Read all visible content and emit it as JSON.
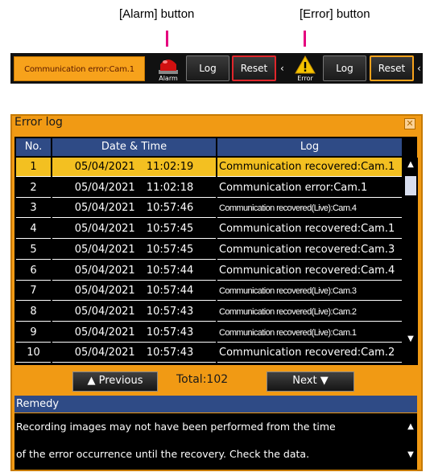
{
  "callouts": {
    "alarm": "[Alarm] button",
    "error": "[Error] button"
  },
  "topbar": {
    "status_text": "Communication error:Cam.1",
    "alarm_label": "Alarm",
    "error_label": "Error",
    "log_label": "Log",
    "reset_label": "Reset",
    "colors": {
      "status": "#f7a21b",
      "alarm_reset_border": "#e0262b",
      "error_reset_border": "#f7a21b"
    }
  },
  "window": {
    "title": "Error log",
    "close_icon": "close-icon",
    "columns": [
      "No.",
      "Date & Time",
      "Log"
    ],
    "rows": [
      {
        "no": "1",
        "date": "05/04/2021",
        "time": "11:02:19",
        "log": "Communication recovered:Cam.1",
        "selected": true,
        "cond": false
      },
      {
        "no": "2",
        "date": "05/04/2021",
        "time": "11:02:18",
        "log": "Communication error:Cam.1",
        "cond": false
      },
      {
        "no": "3",
        "date": "05/04/2021",
        "time": "10:57:46",
        "log": "Communication recovered(Live):Cam.4",
        "cond": true
      },
      {
        "no": "4",
        "date": "05/04/2021",
        "time": "10:57:45",
        "log": "Communication recovered:Cam.1",
        "cond": false
      },
      {
        "no": "5",
        "date": "05/04/2021",
        "time": "10:57:45",
        "log": "Communication recovered:Cam.3",
        "cond": false
      },
      {
        "no": "6",
        "date": "05/04/2021",
        "time": "10:57:44",
        "log": "Communication recovered:Cam.4",
        "cond": false
      },
      {
        "no": "7",
        "date": "05/04/2021",
        "time": "10:57:44",
        "log": "Communication recovered(Live):Cam.3",
        "cond": true
      },
      {
        "no": "8",
        "date": "05/04/2021",
        "time": "10:57:43",
        "log": "Communication recovered(Live):Cam.2",
        "cond": true
      },
      {
        "no": "9",
        "date": "05/04/2021",
        "time": "10:57:43",
        "log": "Communication recovered(Live):Cam.1",
        "cond": true
      },
      {
        "no": "10",
        "date": "05/04/2021",
        "time": "10:57:43",
        "log": "Communication recovered:Cam.2",
        "cond": false
      }
    ],
    "pager": {
      "previous": "▲ Previous",
      "next": "Next ▼",
      "total": "Total:102"
    },
    "remedy": {
      "title": "Remedy",
      "lines": [
        "Recording images may not have been performed from the time",
        "of the error occurrence until the recovery. Check the data."
      ]
    },
    "colors": {
      "frame": "#f19a14",
      "header": "#2f4b86",
      "selected_row": "#f3c021"
    }
  }
}
